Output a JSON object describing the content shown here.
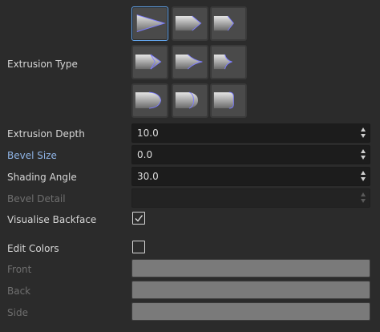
{
  "extrusion": {
    "label": "Extrusion Type",
    "selected_index": 0,
    "options": [
      {
        "icon": "arrow-sharp-icon"
      },
      {
        "icon": "arrow-chisel-icon"
      },
      {
        "icon": "arrow-flat-icon"
      },
      {
        "icon": "arrow-double-point-icon"
      },
      {
        "icon": "arrow-curved-point-icon"
      },
      {
        "icon": "arrow-notch-icon"
      },
      {
        "icon": "round-bevel-icon"
      },
      {
        "icon": "half-round-bevel-icon"
      },
      {
        "icon": "rounded-edge-icon"
      }
    ]
  },
  "fields": {
    "depth": {
      "label": "Extrusion Depth",
      "value": "10.0"
    },
    "bevel_size": {
      "label": "Bevel Size",
      "value": "0.0"
    },
    "shading_angle": {
      "label": "Shading Angle",
      "value": "30.0"
    },
    "bevel_detail": {
      "label": "Bevel Detail",
      "value": ""
    }
  },
  "backface": {
    "label": "Visualise Backface",
    "checked": true
  },
  "edit_colors": {
    "label": "Edit Colors",
    "checked": false
  },
  "colors": {
    "front": {
      "label": "Front",
      "color": "#7a7a7a"
    },
    "back": {
      "label": "Back",
      "color": "#7a7a7a"
    },
    "side": {
      "label": "Side",
      "color": "#7a7a7a"
    }
  },
  "theme": {
    "accent": "#62a3ea",
    "link": "#8fb4e6",
    "background": "#2b2b2b"
  }
}
